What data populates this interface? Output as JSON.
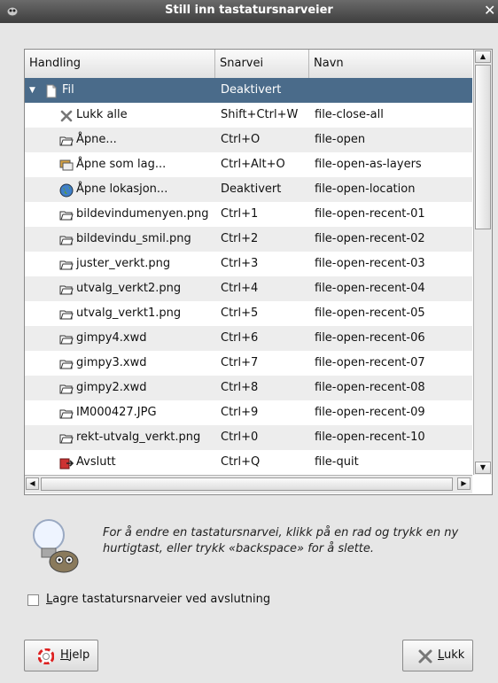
{
  "window": {
    "title": "Still inn tastatursnarveier",
    "close_glyph": "✕"
  },
  "table": {
    "headers": [
      "Handling",
      "Snarvei",
      "Navn"
    ],
    "rows": [
      {
        "label": "Fil",
        "shortcut": "Deaktivert",
        "id": "",
        "icon": "document-icon",
        "selected": true
      },
      {
        "label": "Lukk alle",
        "shortcut": "Shift+Ctrl+W",
        "id": "file-close-all",
        "icon": "close-x-icon"
      },
      {
        "label": "Åpne...",
        "shortcut": "Ctrl+O",
        "id": "file-open",
        "icon": "folder-open-icon"
      },
      {
        "label": "Åpne som lag...",
        "shortcut": "Ctrl+Alt+O",
        "id": "file-open-as-layers",
        "icon": "layers-icon"
      },
      {
        "label": "Åpne lokasjon...",
        "shortcut": "Deaktivert",
        "id": "file-open-location",
        "icon": "globe-icon"
      },
      {
        "label": "bildevindumenyen.png",
        "shortcut": "Ctrl+1",
        "id": "file-open-recent-01",
        "icon": "folder-open-icon"
      },
      {
        "label": "bildevindu_smil.png",
        "shortcut": "Ctrl+2",
        "id": "file-open-recent-02",
        "icon": "folder-open-icon"
      },
      {
        "label": "juster_verkt.png",
        "shortcut": "Ctrl+3",
        "id": "file-open-recent-03",
        "icon": "folder-open-icon"
      },
      {
        "label": "utvalg_verkt2.png",
        "shortcut": "Ctrl+4",
        "id": "file-open-recent-04",
        "icon": "folder-open-icon"
      },
      {
        "label": "utvalg_verkt1.png",
        "shortcut": "Ctrl+5",
        "id": "file-open-recent-05",
        "icon": "folder-open-icon"
      },
      {
        "label": "gimpy4.xwd",
        "shortcut": "Ctrl+6",
        "id": "file-open-recent-06",
        "icon": "folder-open-icon"
      },
      {
        "label": "gimpy3.xwd",
        "shortcut": "Ctrl+7",
        "id": "file-open-recent-07",
        "icon": "folder-open-icon"
      },
      {
        "label": "gimpy2.xwd",
        "shortcut": "Ctrl+8",
        "id": "file-open-recent-08",
        "icon": "folder-open-icon"
      },
      {
        "label": "IM000427.JPG",
        "shortcut": "Ctrl+9",
        "id": "file-open-recent-09",
        "icon": "folder-open-icon"
      },
      {
        "label": "rekt-utvalg_verkt.png",
        "shortcut": "Ctrl+0",
        "id": "file-open-recent-10",
        "icon": "folder-open-icon"
      },
      {
        "label": "Avslutt",
        "shortcut": "Ctrl+Q",
        "id": "file-quit",
        "icon": "quit-icon"
      }
    ]
  },
  "hint": {
    "text": "For å endre en tastatursnarvei, klikk på en rad og trykk en ny hurtigtast, eller trykk «backspace» for å slette."
  },
  "options": {
    "save_on_exit_label": "Lagre tastatursnarveier ved avslutning",
    "save_on_exit_checked": false
  },
  "buttons": {
    "help_label": "Hjelp",
    "close_label": "Lukk"
  },
  "colors": {
    "selection": "#4a6b8a",
    "titlebar": "#4a4a4a"
  }
}
